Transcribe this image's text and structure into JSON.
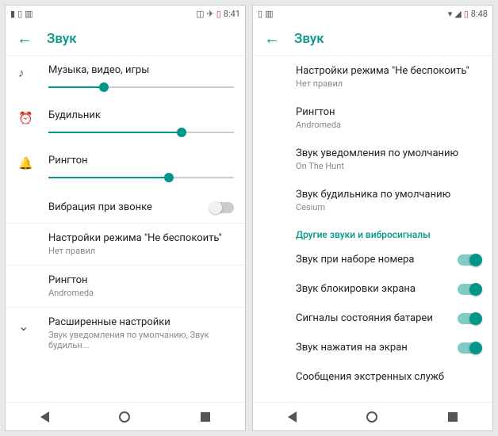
{
  "accent": "#009688",
  "left_screen": {
    "status": {
      "time": "8:41",
      "icons": [
        "no-signal",
        "airplane",
        "battery-low"
      ]
    },
    "title": "Звук",
    "sliders": [
      {
        "icon": "music-note",
        "label": "Музыка, видео, игры",
        "value": 30
      },
      {
        "icon": "alarm-clock",
        "label": "Будильник",
        "value": 72
      },
      {
        "icon": "bell",
        "label": "Рингтон",
        "value": 65
      }
    ],
    "vibration": {
      "label": "Вибрация при звонке",
      "on": false
    },
    "dnd": {
      "title": "Настройки режима \"Не беспокоить\"",
      "sub": "Нет правил"
    },
    "ringtone": {
      "title": "Рингтон",
      "sub": "Andromeda"
    },
    "advanced": {
      "title": "Расширенные настройки",
      "sub": "Звук уведомления по умолчанию, Звук будильн..."
    }
  },
  "right_screen": {
    "status": {
      "time": "8:48",
      "icons": [
        "wifi",
        "signal",
        "battery-low"
      ]
    },
    "title": "Звук",
    "items": [
      {
        "title": "Настройки режима \"Не беспокоить\"",
        "sub": "Нет правил"
      },
      {
        "title": "Рингтон",
        "sub": "Andromeda"
      },
      {
        "title": "Звук уведомления по умолчанию",
        "sub": "On The Hunt"
      },
      {
        "title": "Звук будильника по умолчанию",
        "sub": "Cesium"
      }
    ],
    "section_header": "Другие звуки и вибросигналы",
    "toggles": [
      {
        "label": "Звук при наборе номера",
        "on": true
      },
      {
        "label": "Звук блокировки экрана",
        "on": true
      },
      {
        "label": "Сигналы состояния батареи",
        "on": true
      },
      {
        "label": "Звук нажатия на экран",
        "on": true
      }
    ],
    "last_row": {
      "label": "Сообщения экстренных служб"
    }
  }
}
